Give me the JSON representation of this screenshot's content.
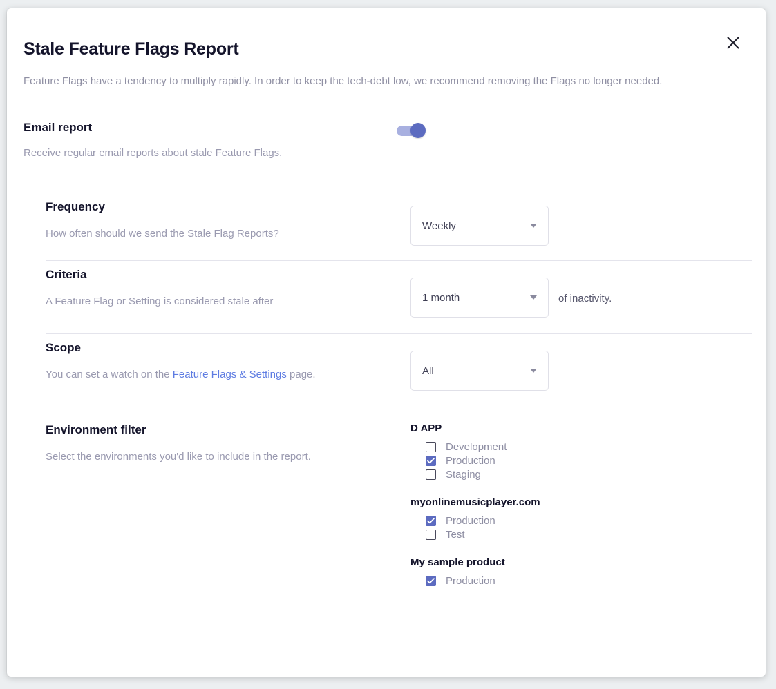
{
  "dialog": {
    "title": "Stale Feature Flags Report",
    "description": "Feature Flags have a tendency to multiply rapidly. In order to keep the tech-debt low, we recommend removing the Flags no longer needed.",
    "close_label": "×"
  },
  "email_report": {
    "title": "Email report",
    "subtitle": "Receive regular email reports about stale Feature Flags.",
    "toggle_state": "on"
  },
  "frequency": {
    "title": "Frequency",
    "subtitle": "How often should we send the Stale Flag Reports?",
    "value": "Weekly"
  },
  "criteria": {
    "title": "Criteria",
    "subtitle": "A Feature Flag or Setting is considered stale after",
    "value": "1 month",
    "suffix": "of inactivity."
  },
  "scope": {
    "title": "Scope",
    "subtitle_before": "You can set a watch on the ",
    "subtitle_link": "Feature Flags & Settings",
    "subtitle_after": " page.",
    "value": "All"
  },
  "environment_filter": {
    "title": "Environment filter",
    "subtitle": "Select the environments you'd like to include in the report.",
    "groups": [
      {
        "name": "D APP",
        "items": [
          {
            "label": "Development",
            "checked": false
          },
          {
            "label": "Production",
            "checked": true
          },
          {
            "label": "Staging",
            "checked": false
          }
        ]
      },
      {
        "name": "myonlinemusicplayer.com",
        "items": [
          {
            "label": "Production",
            "checked": true
          },
          {
            "label": "Test",
            "checked": false
          }
        ]
      },
      {
        "name": "My sample product",
        "items": [
          {
            "label": "Production",
            "checked": true
          }
        ]
      }
    ]
  },
  "colors": {
    "accent": "#5c6bc0",
    "toggle_track": "#a8b0e0",
    "link": "#5e7ce2",
    "heading": "#14142b",
    "muted": "#9a9ab0",
    "divider": "#e4e4ec"
  }
}
